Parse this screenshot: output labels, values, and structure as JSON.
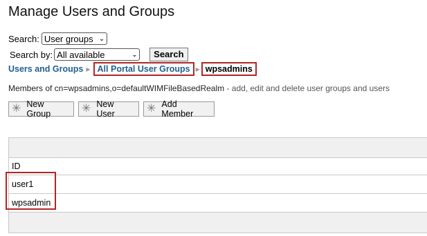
{
  "page": {
    "title": "Manage Users and Groups"
  },
  "search": {
    "label": "Search:",
    "selected": "User groups",
    "by_label": "Search by:",
    "by_selected": "All available",
    "button_label": "Search"
  },
  "breadcrumb": {
    "items": [
      {
        "label": "Users and Groups"
      },
      {
        "label": "All Portal User Groups"
      },
      {
        "label": "wpsadmins"
      }
    ]
  },
  "members": {
    "prefix": "Members of cn=wpsadmins,o=defaultWIMFileBasedRealm",
    "suffix": " - add, edit and delete user groups and users"
  },
  "actions": {
    "new_group": "New Group",
    "new_user": "New User",
    "add_member": "Add Member"
  },
  "table": {
    "column_header": "ID",
    "rows": [
      "user1",
      "wpsadmin"
    ]
  },
  "colors": {
    "highlight": "#b32424",
    "link": "#1f5f8f"
  },
  "icons": {
    "action": "new-item-star-icon",
    "separator": "breadcrumb-arrow-icon",
    "dropdown": "chevron-down-icon"
  }
}
